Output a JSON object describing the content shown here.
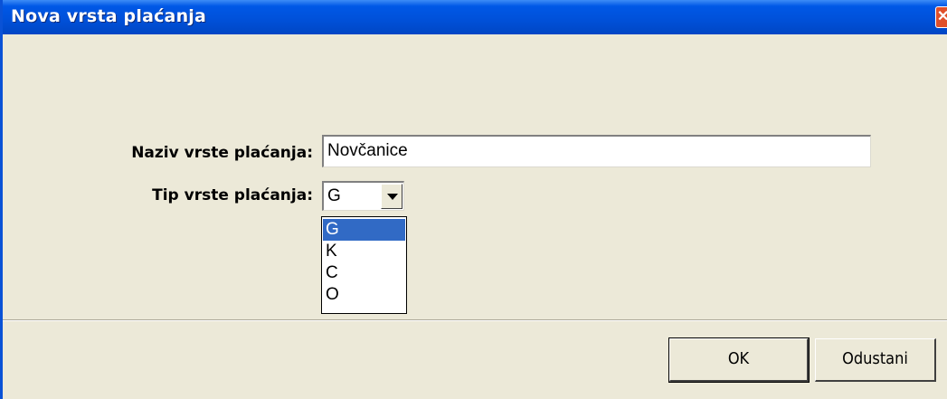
{
  "window": {
    "title": "Nova vrsta plaćanja",
    "close_glyph": "✕"
  },
  "form": {
    "name_label": "Naziv vrste plaćanja:",
    "name_value": "Novčanice",
    "type_label": "Tip vrste plaćanja:",
    "type_value": "G",
    "type_options": [
      "G",
      "K",
      "C",
      "O"
    ],
    "type_selected_option": "G"
  },
  "buttons": {
    "ok_label": "OK",
    "cancel_label": "Odustani"
  },
  "colors": {
    "titlebar": "#0054e3",
    "selection": "#316ac5",
    "dialog_bg": "#ece9d8"
  }
}
